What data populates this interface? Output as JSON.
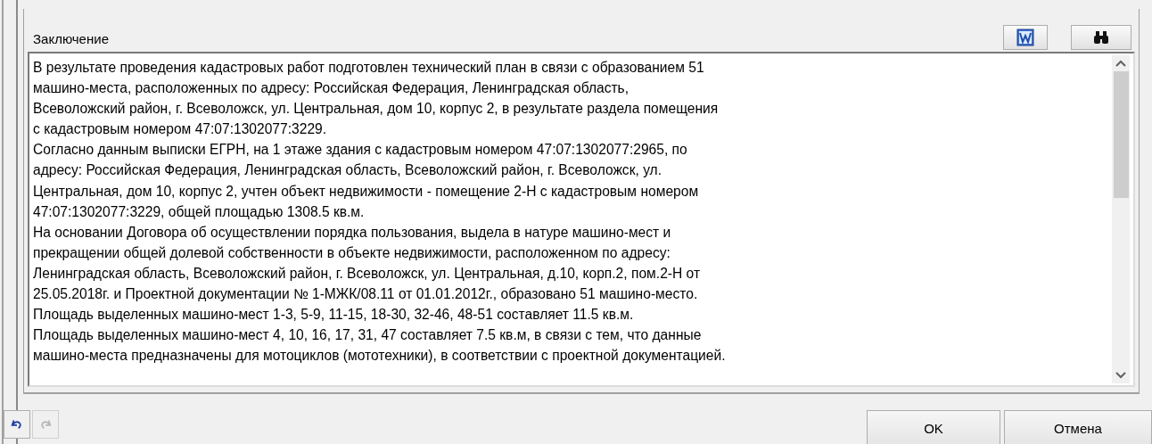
{
  "conclusion": {
    "label": "Заключение",
    "lines": [
      "В результате проведения кадастровых работ подготовлен технический план в связи с образованием 51",
      "машино-места, расположенных по адресу: Российская Федерация, Ленинградская область,",
      "Всеволожский район, г. Всеволожск, ул. Центральная, дом 10, корпус 2, в результате раздела помещения",
      "с кадастровым номером 47:07:1302077:3229.",
      "Согласно данным выписки ЕГРН, на 1 этаже здания с кадастровым номером 47:07:1302077:2965, по",
      "адресу: Российская Федерация, Ленинградская область, Всеволожский район, г. Всеволожск, ул.",
      "Центральная, дом 10, корпус 2, учтен объект недвижимости - помещение 2-Н с кадастровым номером",
      "47:07:1302077:3229, общей площадью 1308.5 кв.м.",
      "На основании Договора об осуществлении порядка пользования, выдела в натуре машино-мест и",
      "прекращении общей долевой собственности в объекте недвижимости, расположенном по адресу:",
      "Ленинградская область, Всеволожский район, г. Всеволожск, ул. Центральная, д.10, корп.2, пом.2-Н от",
      "25.05.2018г. и Проектной документации № 1-МЖК/08.11 от 01.01.2012г., образовано 51 машино-место.",
      "Площадь выделенных машино-мест 1-3, 5-9, 11-15, 18-30, 32-46, 48-51 составляет 11.5 кв.м.",
      "Площадь выделенных машино-мест 4, 10, 16, 17, 31, 47 составляет 7.5 кв.м, в связи с тем, что данные",
      "машино-места предназначены для мотоциклов (мототехники), в соответствии с проектной документацией."
    ]
  },
  "history_buttons": [
    {
      "kind": "undo",
      "disabled": false
    },
    {
      "kind": "redo",
      "disabled": true
    }
  ],
  "buttons": [
    "OK",
    "Отмена"
  ]
}
